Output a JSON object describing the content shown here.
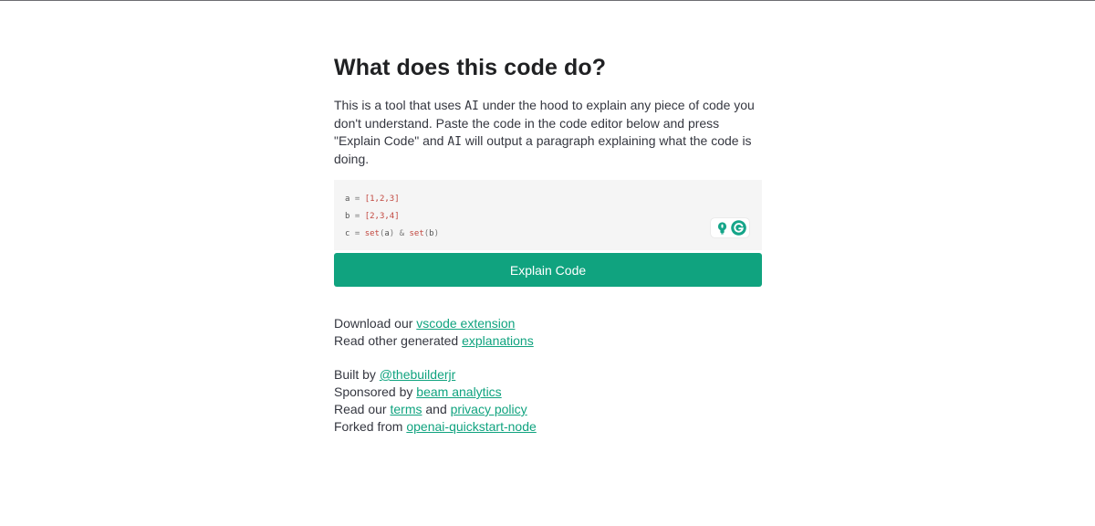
{
  "page": {
    "title": "What does this code do?",
    "intro": {
      "part1": "This is a tool that uses ",
      "ai1": "AI",
      "part2": " under the hood to explain any piece of code you don't understand. Paste the code in the code editor below and press \"Explain Code\" and ",
      "ai2": "AI",
      "part3": " will output a paragraph explaining what the code is doing."
    }
  },
  "editor": {
    "lines": [
      {
        "var": "a",
        "op": " = ",
        "value": "[1,2,3]"
      },
      {
        "var": "b",
        "op": " = ",
        "value": "[2,3,4]"
      },
      {
        "var": "c",
        "op": " = ",
        "fn1": "set",
        "p1open": "(",
        "arg1": "a",
        "p1close": ")",
        "amp": " & ",
        "fn2": "set",
        "p2open": "(",
        "arg2": "b",
        "p2close": ")"
      }
    ],
    "badges": [
      "lightbulb-icon",
      "grammarly-icon"
    ]
  },
  "button": {
    "label": "Explain Code"
  },
  "links": {
    "download": {
      "text": "Download our ",
      "link": "vscode extension"
    },
    "explanations": {
      "text": "Read other generated ",
      "link": "explanations"
    },
    "built": {
      "text": "Built by ",
      "link": "@thebuilderjr"
    },
    "sponsored": {
      "text": "Sponsored by ",
      "link": "beam analytics"
    },
    "terms": {
      "text": "Read our ",
      "link1": "terms",
      "middle": " and ",
      "link2": "privacy policy"
    },
    "forked": {
      "text": "Forked from ",
      "link": "openai-quickstart-node"
    }
  },
  "colors": {
    "accent": "#10a37f",
    "text": "#353740",
    "heading": "#202123",
    "editor_bg": "#f5f5f5",
    "code_literal": "#c2473f"
  }
}
